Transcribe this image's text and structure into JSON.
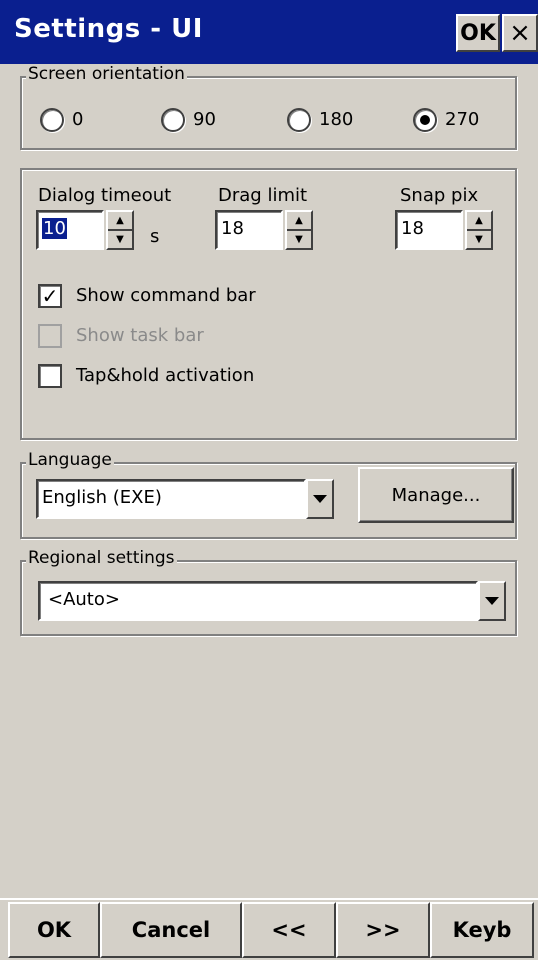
{
  "window": {
    "title": "Settings - UI",
    "ok_label": "OK",
    "close_label": "×"
  },
  "orientation": {
    "legend": "Screen orientation",
    "options": [
      {
        "label": "0",
        "selected": false
      },
      {
        "label": "90",
        "selected": false
      },
      {
        "label": "180",
        "selected": false
      },
      {
        "label": "270",
        "selected": true
      }
    ]
  },
  "general": {
    "dialog_timeout": {
      "label": "Dialog timeout",
      "value": "10",
      "unit": "s"
    },
    "drag_limit": {
      "label": "Drag limit",
      "value": "18"
    },
    "snap_pix": {
      "label": "Snap pix",
      "value": "18"
    },
    "checkboxes": [
      {
        "label": "Show command bar",
        "checked": true,
        "enabled": true
      },
      {
        "label": "Show task bar",
        "checked": false,
        "enabled": false
      },
      {
        "label": "Tap&hold activation",
        "checked": false,
        "enabled": true
      }
    ]
  },
  "language": {
    "legend": "Language",
    "selected": "English (EXE)",
    "manage_label": "Manage..."
  },
  "regional": {
    "legend": "Regional settings",
    "selected": "<Auto>"
  },
  "bottom_bar": {
    "ok": "OK",
    "cancel": "Cancel",
    "prev": "<<",
    "next": ">>",
    "keyb": "Keyb"
  },
  "colors": {
    "title_bar": "#0a1f8f",
    "face": "#d4d0c8"
  }
}
